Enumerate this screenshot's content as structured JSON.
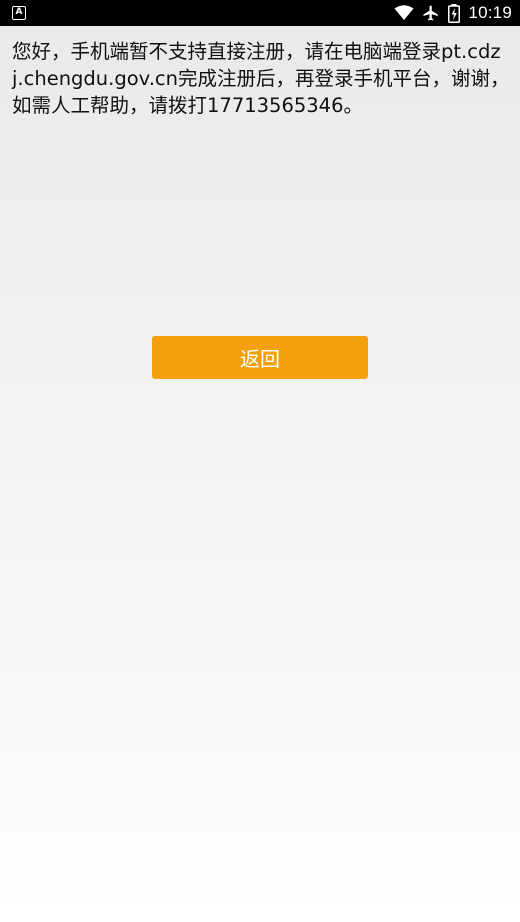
{
  "status_bar": {
    "app_icon_letter": "A",
    "time": "10:19",
    "icons": [
      "wifi-icon",
      "airplane-mode-icon",
      "battery-icon"
    ]
  },
  "message": {
    "text": "您好，手机端暂不支持直接注册，请在电脑端登录pt.cdzj.chengdu.gov.cn完成注册后，再登录手机平台，谢谢，如需人工帮助，请拨打17713565346。"
  },
  "actions": {
    "back_label": "返回"
  },
  "colors": {
    "status_bar": "#000000",
    "button": "#f5a00f",
    "button_text": "#ffffff",
    "text": "#111111"
  }
}
